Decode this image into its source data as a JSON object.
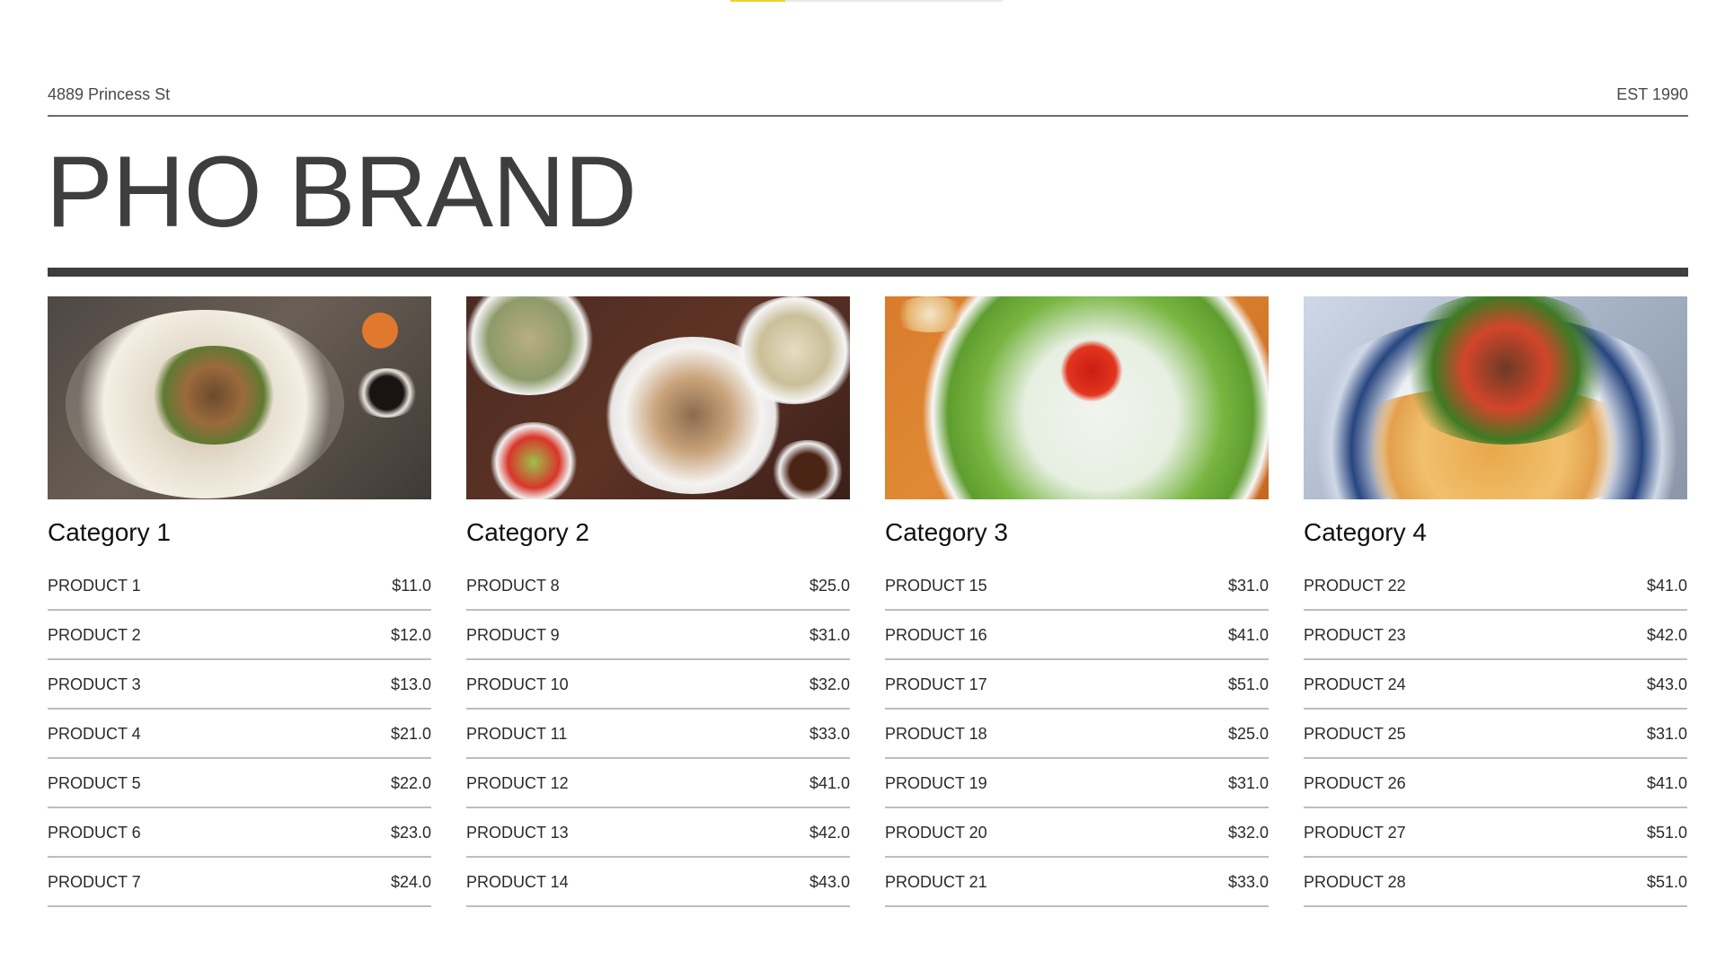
{
  "header": {
    "address": "4889 Princess St",
    "established": "EST 1990",
    "brand": "PHO BRAND"
  },
  "progress": {
    "fraction": 0.2,
    "color": "#f2d12f"
  },
  "categories": [
    {
      "title": "Category 1",
      "image": "stir-fry-in-crispy-noodle-nest-photo",
      "products": [
        {
          "name": "PRODUCT 1",
          "price": "$11.0"
        },
        {
          "name": "PRODUCT 2",
          "price": "$12.0"
        },
        {
          "name": "PRODUCT 3",
          "price": "$13.0"
        },
        {
          "name": "PRODUCT 4",
          "price": "$21.0"
        },
        {
          "name": "PRODUCT 5",
          "price": "$22.0"
        },
        {
          "name": "PRODUCT 6",
          "price": "$23.0"
        },
        {
          "name": "PRODUCT 7",
          "price": "$24.0"
        }
      ]
    },
    {
      "title": "Category 2",
      "image": "pho-bowls-with-herbs-photo",
      "products": [
        {
          "name": "PRODUCT 8",
          "price": "$25.0"
        },
        {
          "name": "PRODUCT 9",
          "price": "$31.0"
        },
        {
          "name": "PRODUCT 10",
          "price": "$32.0"
        },
        {
          "name": "PRODUCT 11",
          "price": "$33.0"
        },
        {
          "name": "PRODUCT 12",
          "price": "$41.0"
        },
        {
          "name": "PRODUCT 13",
          "price": "$42.0"
        },
        {
          "name": "PRODUCT 14",
          "price": "$43.0"
        }
      ]
    },
    {
      "title": "Category 3",
      "image": "fresh-rolls-on-lettuce-platter-photo",
      "products": [
        {
          "name": "PRODUCT 15",
          "price": "$31.0"
        },
        {
          "name": "PRODUCT 16",
          "price": "$41.0"
        },
        {
          "name": "PRODUCT 17",
          "price": "$51.0"
        },
        {
          "name": "PRODUCT 18",
          "price": "$25.0"
        },
        {
          "name": "PRODUCT 19",
          "price": "$31.0"
        },
        {
          "name": "PRODUCT 20",
          "price": "$32.0"
        },
        {
          "name": "PRODUCT 21",
          "price": "$33.0"
        }
      ]
    },
    {
      "title": "Category 4",
      "image": "beef-stir-fry-on-fried-dough-photo",
      "products": [
        {
          "name": "PRODUCT 22",
          "price": "$41.0"
        },
        {
          "name": "PRODUCT 23",
          "price": "$42.0"
        },
        {
          "name": "PRODUCT 24",
          "price": "$43.0"
        },
        {
          "name": "PRODUCT 25",
          "price": "$31.0"
        },
        {
          "name": "PRODUCT 26",
          "price": "$41.0"
        },
        {
          "name": "PRODUCT 27",
          "price": "$51.0"
        },
        {
          "name": "PRODUCT 28",
          "price": "$51.0"
        }
      ]
    }
  ]
}
